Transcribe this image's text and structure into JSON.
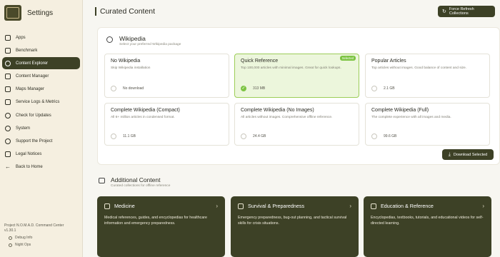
{
  "sidebar": {
    "title": "Settings",
    "logo_text": "NOMAD",
    "items": [
      {
        "label": "Apps",
        "icon": "terminal-icon"
      },
      {
        "label": "Benchmark",
        "icon": "chart-icon"
      },
      {
        "label": "Content Explorer",
        "icon": "search-icon",
        "active": true
      },
      {
        "label": "Content Manager",
        "icon": "folder-icon"
      },
      {
        "label": "Maps Manager",
        "icon": "map-icon"
      },
      {
        "label": "Service Logs & Metrics",
        "icon": "logs-icon"
      },
      {
        "label": "Check for Updates",
        "icon": "refresh-icon"
      },
      {
        "label": "System",
        "icon": "gear-icon"
      },
      {
        "label": "Support the Project",
        "icon": "heart-icon"
      },
      {
        "label": "Legal Notices",
        "icon": "document-icon"
      },
      {
        "label": "Back to Home",
        "icon": "arrow-left-icon"
      }
    ],
    "footer": {
      "line1": "Project N.O.M.A.D. Command Center",
      "version": "v1.30.1",
      "debug": "Debug Info",
      "theme": "Night Ops"
    }
  },
  "header": {
    "title": "Curated Content",
    "refresh_label": "Force Refresh Collections"
  },
  "wikipedia": {
    "title": "Wikipedia",
    "subtitle": "Select your preferred Wikipedia package",
    "selected_badge": "Selected",
    "download_label": "Download Selected",
    "options": [
      {
        "title": "No Wikipedia",
        "desc": "Skip Wikipedia installation",
        "size": "No download",
        "selected": false
      },
      {
        "title": "Quick Reference",
        "desc": "Top 100,000 articles with minimal images. Great for quick lookups.",
        "size": "313 MB",
        "selected": true
      },
      {
        "title": "Popular Articles",
        "desc": "Top articles without images. Good balance of content and size.",
        "size": "2.1 GB",
        "selected": false
      },
      {
        "title": "Complete Wikipedia (Compact)",
        "desc": "All 6+ million articles in condensed format.",
        "size": "11.1 GB",
        "selected": false
      },
      {
        "title": "Complete Wikipedia (No Images)",
        "desc": "All articles without images. Comprehensive offline reference.",
        "size": "24.4 GB",
        "selected": false
      },
      {
        "title": "Complete Wikipedia (Full)",
        "desc": "The complete experience with all images and media.",
        "size": "99.6 GB",
        "selected": false
      }
    ]
  },
  "additional": {
    "title": "Additional Content",
    "subtitle": "Curated collections for offline reference",
    "collections": [
      {
        "title": "Medicine",
        "icon": "medical-icon",
        "desc": "Medical references, guides, and encyclopedias for healthcare information and emergency preparedness."
      },
      {
        "title": "Survival & Preparedness",
        "icon": "shield-icon",
        "desc": "Emergency preparedness, bug-out planning, and tactical survival skills for crisis situations."
      },
      {
        "title": "Education & Reference",
        "icon": "book-icon",
        "desc": "Encyclopedias, textbooks, tutorials, and educational videos for self-directed learning."
      }
    ]
  }
}
